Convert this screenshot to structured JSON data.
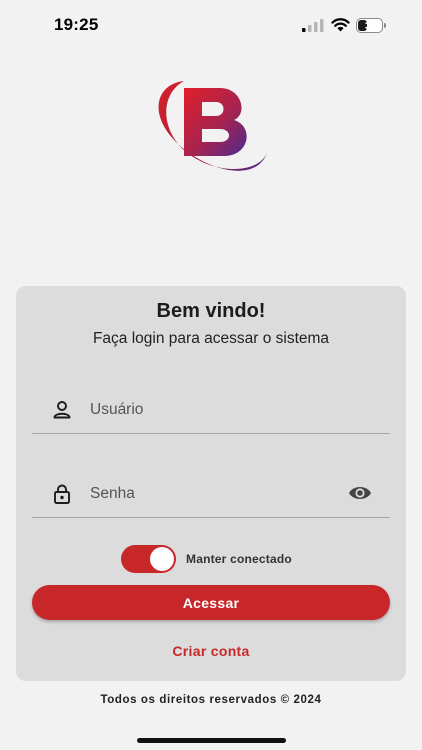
{
  "status_bar": {
    "time": "19:25",
    "battery_level": "37",
    "battery_fraction": 0.37,
    "icons": [
      "signal-icon",
      "wifi-icon",
      "battery-icon"
    ]
  },
  "logo": {
    "letter": "B",
    "colors": {
      "red": "#d3202b",
      "purple": "#4b2b8f"
    }
  },
  "card": {
    "title": "Bem vindo!",
    "subtitle": "Faça login para acessar o sistema",
    "username_placeholder": "Usuário",
    "password_placeholder": "Senha",
    "keep_connected_label": "Manter conectado",
    "keep_connected_on": true,
    "submit_label": "Acessar",
    "create_account_label": "Criar conta"
  },
  "footer": {
    "text": "Todos os direitos reservados © 2024"
  },
  "colors": {
    "accent": "#c8272a",
    "background": "#f2f2f2",
    "card": "#dcdcdc"
  }
}
